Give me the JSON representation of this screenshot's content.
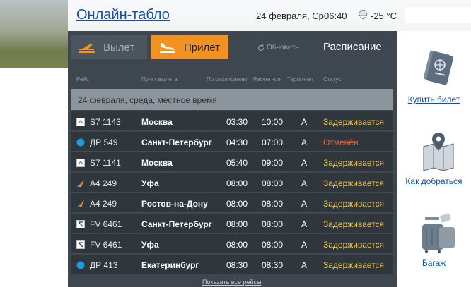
{
  "header": {
    "title": "Онлайн-табло",
    "date": "24 февраля, Ср",
    "time": "06:40",
    "temperature": "-25 °C",
    "weather_icon": "cloud-snow-icon"
  },
  "tabs": [
    {
      "label": "Вылет",
      "icon": "plane-departure-icon",
      "active": false
    },
    {
      "label": "Прилет",
      "icon": "plane-arrival-icon",
      "active": true
    }
  ],
  "toolbar": {
    "refresh_label": "Обновить",
    "schedule_label": "Расписание"
  },
  "columns": {
    "flight": "Рейс",
    "origin": "Пункт вылета",
    "scheduled": "По расписанию",
    "estimated": "Расчетное",
    "terminal": "Терминал",
    "status": "Статус"
  },
  "date_bar": "24 февраля, среда, местное время",
  "flights": [
    {
      "icon": "s7-logo-icon",
      "flight": "S7 1143",
      "city": "Москва",
      "scheduled": "03:30",
      "estimated": "10:00",
      "terminal": "A",
      "status": "Задерживается",
      "status_type": "delayed"
    },
    {
      "icon": "dr-logo-icon",
      "flight": "ДР 549",
      "city": "Санкт-Петербург",
      "scheduled": "04:30",
      "estimated": "07:00",
      "terminal": "A",
      "status": "Отменён",
      "status_type": "cancelled"
    },
    {
      "icon": "s7-logo-icon",
      "flight": "S7 1141",
      "city": "Москва",
      "scheduled": "05:40",
      "estimated": "09:00",
      "terminal": "A",
      "status": "Задерживается",
      "status_type": "delayed"
    },
    {
      "icon": "a4-logo-icon",
      "flight": "А4 249",
      "city": "Уфа",
      "scheduled": "08:00",
      "estimated": "08:00",
      "terminal": "A",
      "status": "Задерживается",
      "status_type": "delayed"
    },
    {
      "icon": "a4-logo-icon",
      "flight": "А4 249",
      "city": "Ростов-на-Дону",
      "scheduled": "08:00",
      "estimated": "08:00",
      "terminal": "A",
      "status": "Задерживается",
      "status_type": "delayed"
    },
    {
      "icon": "fv-logo-icon",
      "flight": "FV 6461",
      "city": "Санкт-Петербург",
      "scheduled": "08:00",
      "estimated": "08:00",
      "terminal": "A",
      "status": "Задерживается",
      "status_type": "delayed"
    },
    {
      "icon": "fv-logo-icon",
      "flight": "FV 6461",
      "city": "Уфа",
      "scheduled": "08:00",
      "estimated": "08:00",
      "terminal": "A",
      "status": "Задерживается",
      "status_type": "delayed"
    },
    {
      "icon": "dr-logo-icon",
      "flight": "ДР 413",
      "city": "Екатеринбург",
      "scheduled": "08:30",
      "estimated": "08:30",
      "terminal": "A",
      "status": "Задерживается",
      "status_type": "delayed"
    }
  ],
  "show_all_label": "Показать все рейсы",
  "sidebar": [
    {
      "label": "Купить билет",
      "icon": "passport-icon"
    },
    {
      "label": "Как добраться",
      "icon": "map-pin-icon"
    },
    {
      "label": "Багаж",
      "icon": "luggage-icon"
    }
  ],
  "colors": {
    "board": "#3e4750",
    "accent": "#f29222",
    "delayed": "#f3c94a",
    "cancelled": "#f0603f",
    "link": "#1c4fa3"
  }
}
